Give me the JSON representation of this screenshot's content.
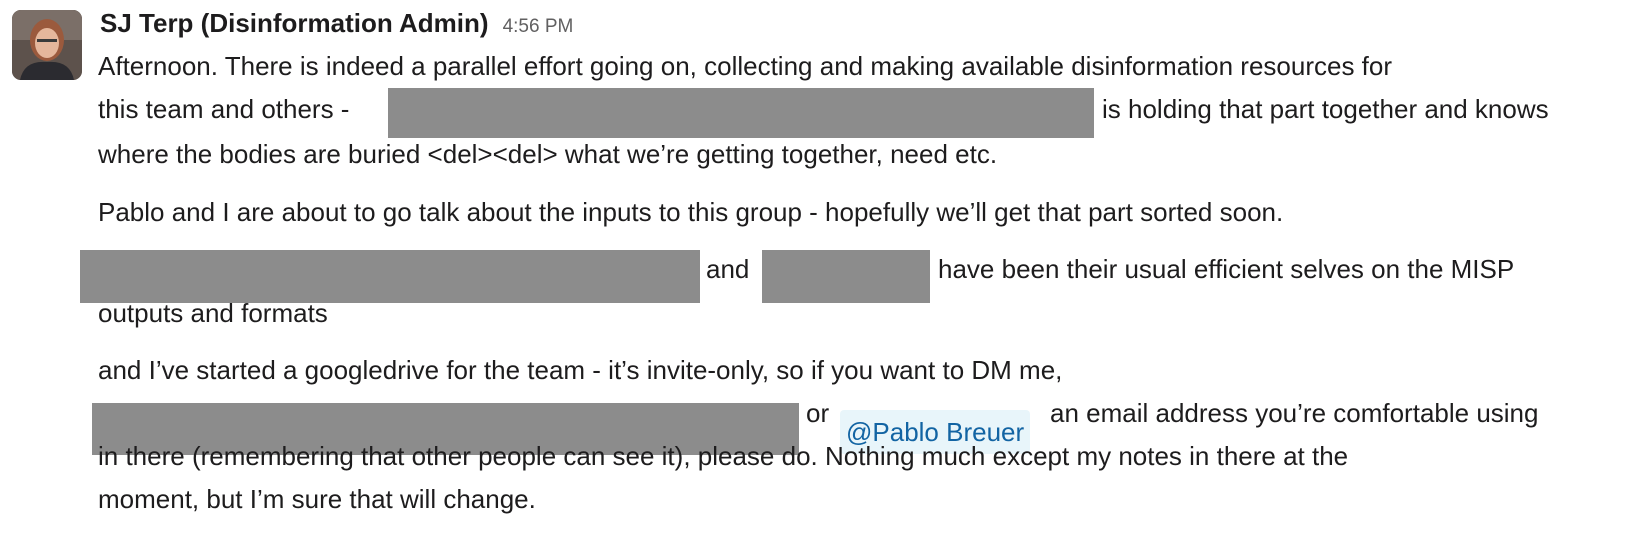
{
  "message": {
    "author": "SJ Terp (Disinformation Admin)",
    "time": "4:56 PM",
    "avatar_icon": "user-avatar-photo",
    "lines": {
      "l1": "Afternoon.  There is indeed a parallel effort going on, collecting and making available disinformation resources for",
      "l2a": "this team and others -",
      "l2b": "is holding that part together and knows",
      "l3": "where the bodies are buried <del><del> what we’re getting together, need etc.",
      "l4": "Pablo and I are about to go talk about the inputs to this group - hopefully we’ll get that part sorted soon.",
      "l5a": "and",
      "l5b": "have been their usual efficient selves on the MISP",
      "l6": "outputs and formats",
      "l7": "and I’ve started a googledrive for the team - it’s invite-only, so if you want to DM me,",
      "l8a": "or",
      "l8b": "an email address you’re comfortable using",
      "l9": "in there (remembering that other people can see it), please do.  Nothing much except my notes in there at the",
      "l10": "moment, but I’m sure that will change."
    },
    "mention": "@Pablo Breuer",
    "redaction_color": "#8c8c8c",
    "mention_colors": {
      "background": "#e8f5fa",
      "text": "#1264a3"
    }
  }
}
